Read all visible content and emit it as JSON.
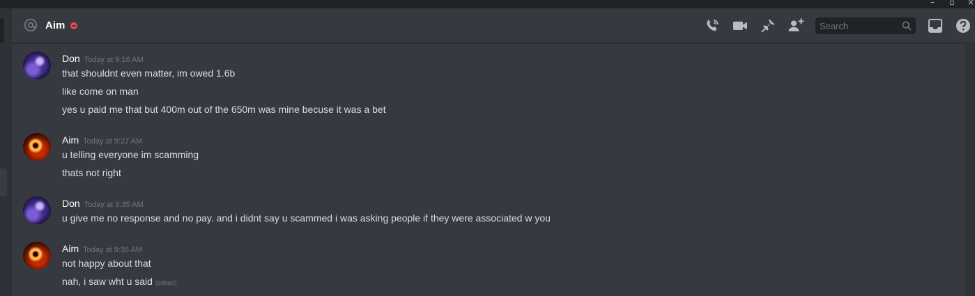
{
  "header": {
    "recipient": "Aim",
    "search_placeholder": "Search"
  },
  "icons": {
    "at": "at-icon",
    "status": "dnd-status-icon",
    "call": "phone-call-icon",
    "video": "video-camera-icon",
    "pin": "pin-icon",
    "add_friend": "add-friend-icon",
    "search": "search-icon",
    "inbox": "inbox-icon",
    "help": "help-icon"
  },
  "colors": {
    "background": "#36393f",
    "header_text": "#ffffff",
    "message_text": "#dcddde",
    "timestamp": "#72767d",
    "dnd": "#f04747"
  },
  "messages": [
    {
      "author": "Don",
      "timestamp": "Today at 9:16 AM",
      "lines": [
        "that shouldnt even matter, im owed 1.6b",
        "like come on man",
        "yes u paid me that but 400m out of the 650m was mine becuse it was a bet"
      ]
    },
    {
      "author": "Aim",
      "timestamp": "Today at 9:27 AM",
      "lines": [
        "u telling everyone im scamming",
        "thats not right"
      ]
    },
    {
      "author": "Don",
      "timestamp": "Today at 9:35 AM",
      "lines": [
        "u give me no response and no pay. and i didnt say u scammed i was asking people if they were associated w you"
      ]
    },
    {
      "author": "Aim",
      "timestamp": "Today at 9:35 AM",
      "lines": [
        "not happy about that",
        "nah, i saw wht u said"
      ],
      "edited_label": "(edited)"
    }
  ]
}
